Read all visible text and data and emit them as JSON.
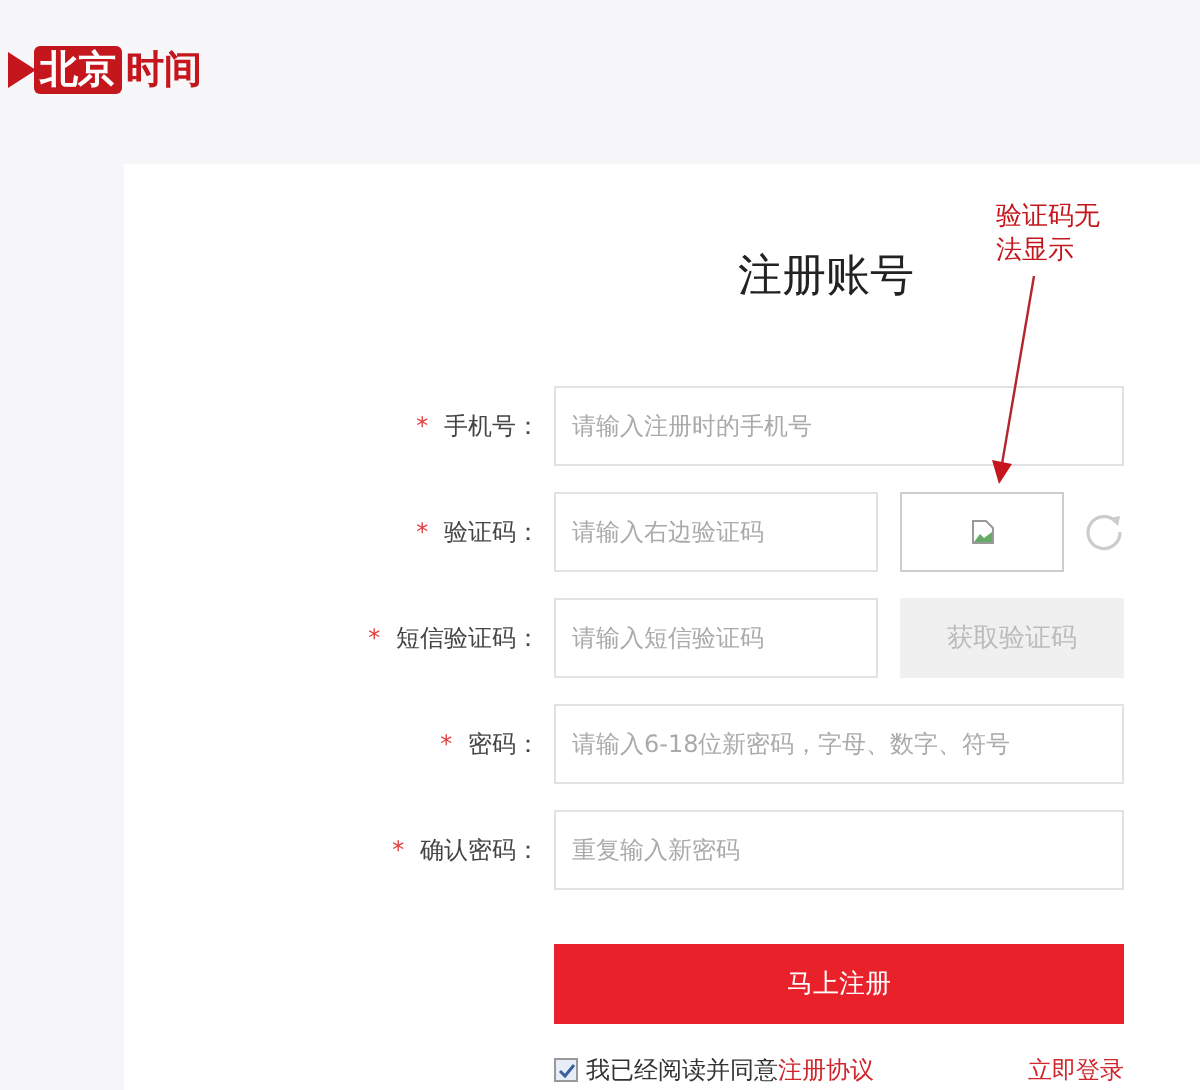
{
  "logo": {
    "boxed": "北京",
    "plain": "时间"
  },
  "title": "注册账号",
  "annotation": "验证码无法显示",
  "fields": [
    {
      "kind": "input",
      "label": "手机号：",
      "mark": "*",
      "placeholder": "请输入注册时的手机号"
    },
    {
      "kind": "captcha",
      "label": "验证码：",
      "mark": "*",
      "placeholder": "请输入右边验证码"
    },
    {
      "kind": "sms",
      "label": "短信验证码：",
      "mark": "*",
      "placeholder": "请输入短信验证码",
      "button": "获取验证码",
      "disabled": true
    },
    {
      "kind": "input",
      "label": "密码：",
      "mark": "*",
      "placeholder": "请输入6-18位新密码，字母、数字、符号"
    },
    {
      "kind": "input",
      "label": "确认密码：",
      "mark": "*",
      "placeholder": "重复输入新密码"
    }
  ],
  "submit": "马上注册",
  "agreement": {
    "checked": true,
    "text": "我已经阅读并同意",
    "link": "注册协议"
  },
  "login_link": "立即登录"
}
